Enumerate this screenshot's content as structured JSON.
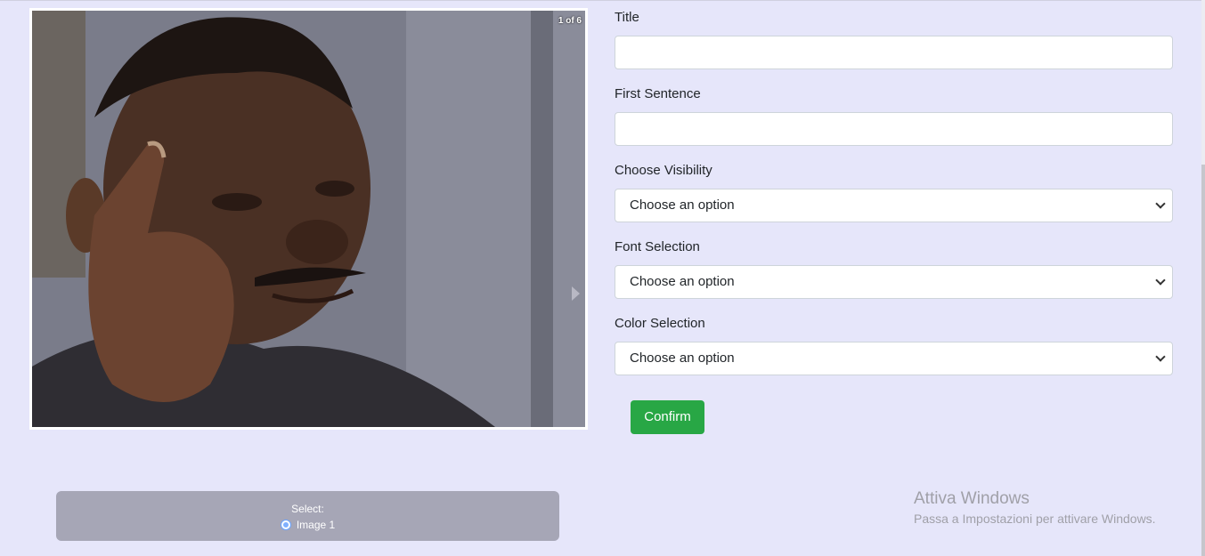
{
  "slideshow": {
    "counter": "1 of 6",
    "image_icon": "meme-image-thinking-man",
    "next_icon": "chevron-right-icon"
  },
  "selector": {
    "label": "Select:",
    "options": [
      "Image 1"
    ]
  },
  "form": {
    "title_label": "Title",
    "title_value": "",
    "first_sentence_label": "First Sentence",
    "first_sentence_value": "",
    "visibility_label": "Choose Visibility",
    "visibility_value": "Choose an option",
    "font_label": "Font Selection",
    "font_value": "Choose an option",
    "color_label": "Color Selection",
    "color_value": "Choose an option",
    "confirm_label": "Confirm"
  },
  "watermark": {
    "title": "Attiva Windows",
    "subtitle": "Passa a Impostazioni per attivare Windows."
  },
  "colors": {
    "background": "#e6e6fa",
    "confirm": "#28a745",
    "selector_box": "#a6a6b6"
  }
}
